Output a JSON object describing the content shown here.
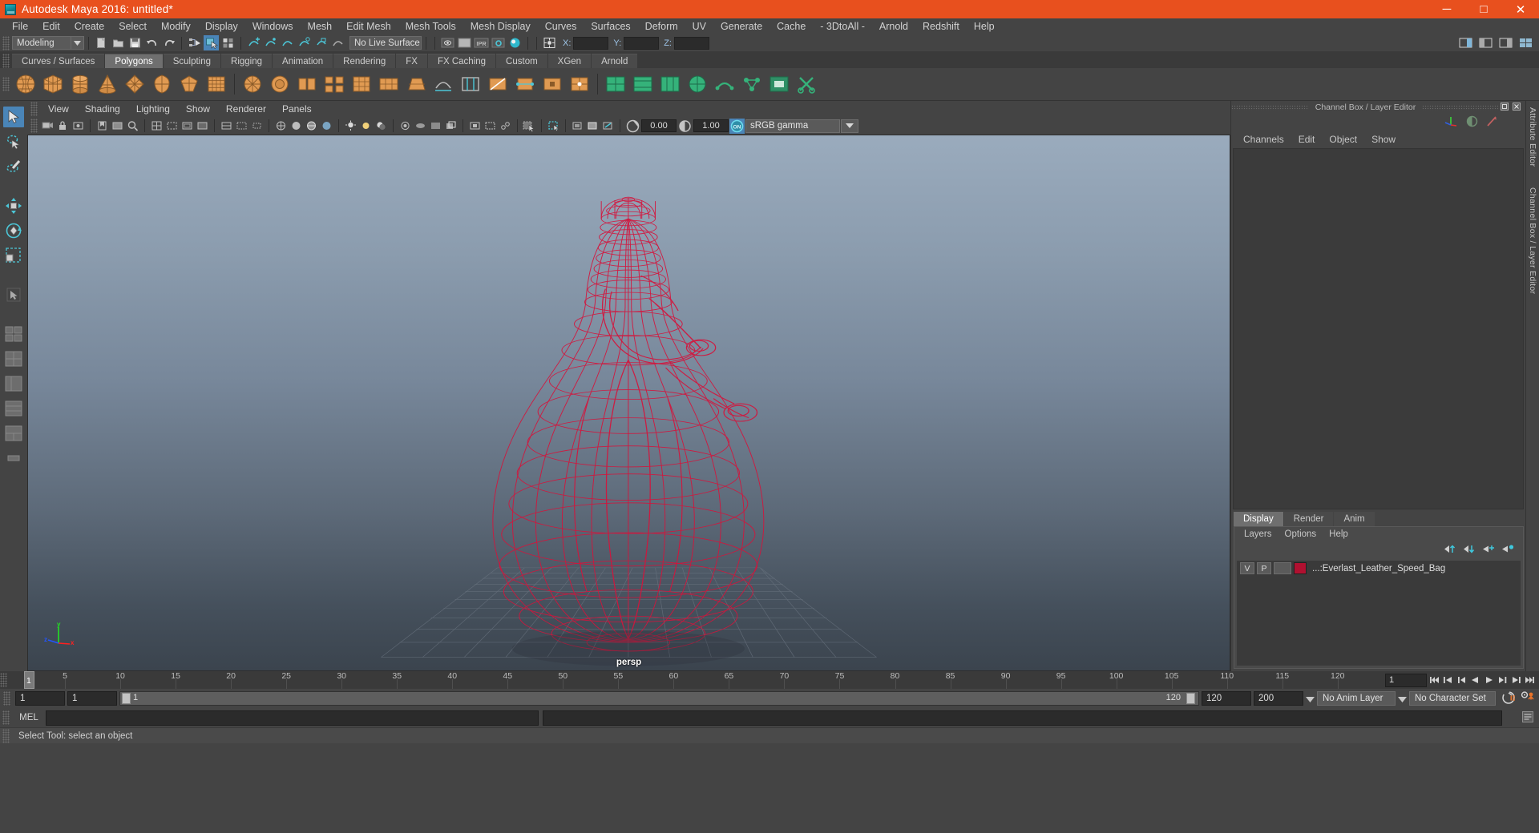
{
  "window": {
    "title": "Autodesk Maya 2016: untitled*",
    "app_icon": "maya-logo-icon",
    "minimize_label": "─",
    "maximize_label": "□",
    "close_label": "✕",
    "titlebar_color": "#e8501e"
  },
  "menubar": {
    "items": [
      "File",
      "Edit",
      "Create",
      "Select",
      "Modify",
      "Display",
      "Windows",
      "Mesh",
      "Edit Mesh",
      "Mesh Tools",
      "Mesh Display",
      "Curves",
      "Surfaces",
      "Deform",
      "UV",
      "Generate",
      "Cache",
      "- 3DtoAll -",
      "Arnold",
      "Redshift",
      "Help"
    ]
  },
  "statusline": {
    "menuset": "Modeling",
    "live_surface": "No Live Surface",
    "coords": {
      "x_label": "X:",
      "y_label": "Y:",
      "z_label": "Z:",
      "x_value": "",
      "y_value": "",
      "z_value": ""
    },
    "icons": [
      "new-scene-icon",
      "open-scene-icon",
      "save-scene-icon",
      "undo-icon",
      "redo-icon",
      "select-by-hierarchy-icon",
      "select-by-object-icon",
      "select-by-component-icon",
      "snap-to-curve-icon",
      "snap-to-grid-icon",
      "snap-to-point-icon",
      "snap-to-projected-icon",
      "snap-to-view-plane-icon",
      "make-live-icon",
      "render-view-icon",
      "render-current-frame-icon",
      "ipr-render-icon",
      "render-settings-icon",
      "hypershade-icon",
      "input-output-icon"
    ]
  },
  "shelf": {
    "tabs": [
      "Curves / Surfaces",
      "Polygons",
      "Sculpting",
      "Rigging",
      "Animation",
      "Rendering",
      "FX",
      "FX Caching",
      "Custom",
      "XGen",
      "Arnold"
    ],
    "active_tab": "Polygons",
    "buttons": [
      "poly-sphere-icon",
      "poly-cube-icon",
      "poly-cylinder-icon",
      "poly-cone-icon",
      "poly-torus-icon",
      "poly-plane-icon",
      "poly-disc-icon",
      "poly-platonic-icon",
      "smooth-icon",
      "sculpt-icon",
      "combine-icon",
      "extract-icon",
      "booleans-icon",
      "mirror-icon",
      "bevel-icon",
      "bridge-icon",
      "append-polygon-icon",
      "insert-edge-loop-icon",
      "offset-edge-loop-icon",
      "multi-cut-icon",
      "quad-draw-icon",
      "target-weld-icon",
      "connect-icon",
      "crease-icon",
      "slide-edge-icon",
      "chamfer-vertex-icon",
      "uv-editor-icon",
      "auto-uv-icon",
      "planar-map-icon",
      "cylindrical-map-icon",
      "spherical-map-icon",
      "uv-layout-icon",
      "unfold-icon",
      "uv-snapshot-icon"
    ]
  },
  "toolbox": {
    "tools": [
      {
        "name": "select-tool",
        "selected": true
      },
      {
        "name": "lasso-select-tool",
        "selected": false
      },
      {
        "name": "paint-select-tool",
        "selected": false
      },
      {
        "name": "move-tool",
        "selected": false
      },
      {
        "name": "rotate-tool",
        "selected": false
      },
      {
        "name": "scale-tool",
        "selected": false
      },
      {
        "name": "last-tool-used",
        "selected": false
      },
      {
        "name": "single-perspective-layout",
        "selected": false
      },
      {
        "name": "four-view-layout",
        "selected": false
      },
      {
        "name": "persp-outliner-layout",
        "selected": false
      },
      {
        "name": "hypergraph-layout",
        "selected": false
      },
      {
        "name": "persp-graph-layout",
        "selected": false
      },
      {
        "name": "more-layouts",
        "selected": false
      }
    ]
  },
  "viewport": {
    "menus": [
      "View",
      "Shading",
      "Lighting",
      "Show",
      "Renderer",
      "Panels"
    ],
    "camera_label": "persp",
    "gamma_value": "0.00",
    "exposure_value": "1.00",
    "color_management": "sRGB gamma",
    "color_management_toggle": "ON",
    "axis": {
      "x": "x",
      "y": "y",
      "z": "z",
      "x_color": "#ff2020",
      "y_color": "#22e022",
      "z_color": "#2255ff"
    },
    "model_name": "Everlast Leather Speed Bag wireframe",
    "wireframe_color": "#d4143c",
    "toolbar_icons": [
      "select-camera-icon",
      "lock-camera-icon",
      "camera-attributes-icon",
      "bookmarks-icon",
      "image-plane-icon",
      "2d-pan-zoom-icon",
      "grid-toggle-icon",
      "film-gate-icon",
      "resolution-gate-icon",
      "gate-mask-icon",
      "field-chart-icon",
      "safe-action-icon",
      "safe-title-icon",
      "wireframe-icon",
      "smooth-shade-icon",
      "shaded-textured-icon",
      "use-lights-icon",
      "shadows-icon",
      "screen-space-ao-icon",
      "motion-blur-icon",
      "multisample-icon",
      "isolate-select-icon",
      "xray-icon",
      "xray-joints-icon",
      "exposure-icon",
      "gamma-icon",
      "color-management-icon"
    ]
  },
  "right_panel": {
    "title": "Channel Box / Layer Editor",
    "restore_icon": "restore-panel-icon",
    "close_icon": "close-panel-icon",
    "header_icons": [
      "show-manipulator-icon",
      "channel-box-toggle-icon",
      "attribute-editor-toggle-icon"
    ],
    "channelbox": {
      "menus": [
        "Channels",
        "Edit",
        "Object",
        "Show"
      ]
    },
    "layer_editor": {
      "tabs": [
        "Display",
        "Render",
        "Anim"
      ],
      "active_tab": "Display",
      "menus": [
        "Layers",
        "Options",
        "Help"
      ],
      "buttons": [
        "move-layer-up-icon",
        "move-layer-down-icon",
        "new-layer-icon",
        "new-layer-from-selected-icon"
      ],
      "layers": [
        {
          "visibility": "V",
          "playback": "P",
          "type": "",
          "color": "#b01030",
          "name": "...:Everlast_Leather_Speed_Bag"
        }
      ]
    },
    "side_tabs": [
      "Attribute Editor",
      "Channel Box / Layer Editor"
    ]
  },
  "timeline": {
    "current_frame": "1",
    "ticks": [
      5,
      10,
      15,
      20,
      25,
      30,
      35,
      40,
      45,
      50,
      55,
      60,
      65,
      70,
      75,
      80,
      85,
      90,
      95,
      100,
      105,
      110,
      115,
      120
    ],
    "frame_field": "1",
    "playback_buttons": [
      "go-to-start-icon",
      "step-back-key-icon",
      "step-back-frame-icon",
      "play-backwards-icon",
      "play-forwards-icon",
      "step-forward-frame-icon",
      "step-forward-key-icon",
      "go-to-end-icon"
    ]
  },
  "range_bar": {
    "range_start": "1",
    "range_start_inner": "1",
    "slider_start": "1",
    "slider_end": "120",
    "range_end_inner": "120",
    "range_end": "200",
    "anim_layer": "No Anim Layer",
    "character_set": "No Character Set",
    "auto_key_icon": "auto-keyframe-icon",
    "anim_prefs_icon": "animation-preferences-icon"
  },
  "command_line": {
    "language_label": "MEL",
    "input_value": "",
    "input_placeholder": ""
  },
  "status_bar": {
    "help_text": "Select Tool: select an object"
  }
}
